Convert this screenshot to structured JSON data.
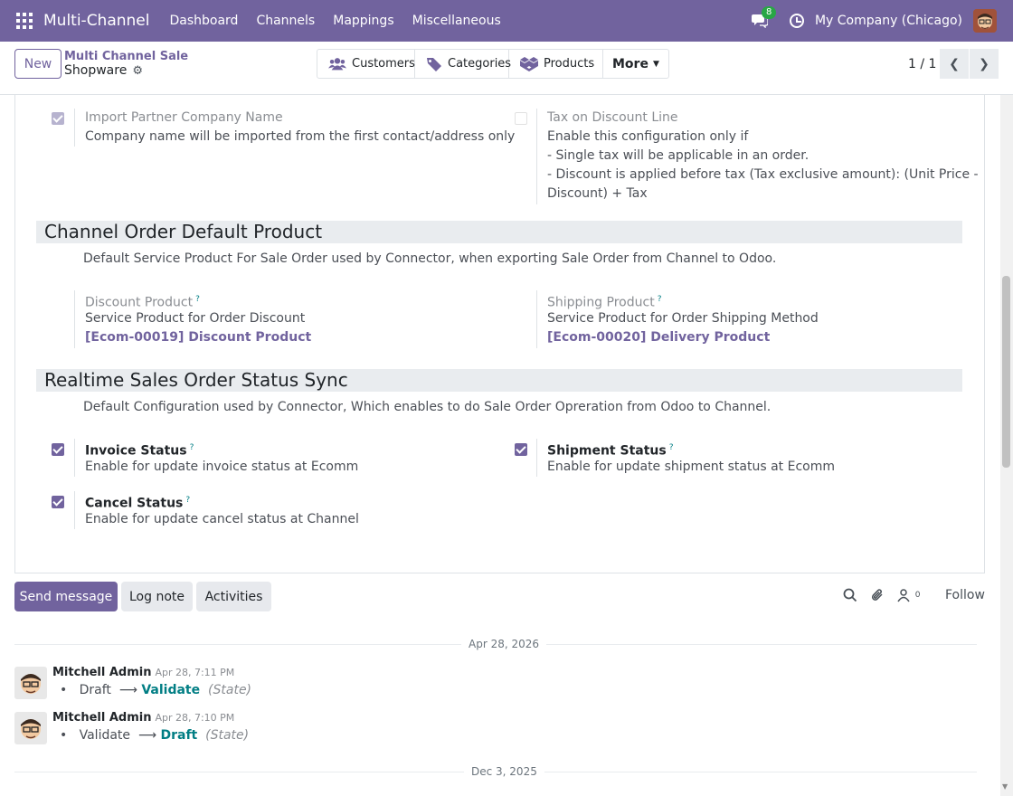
{
  "navbar": {
    "brand": "Multi-Channel",
    "menu": [
      "Dashboard",
      "Channels",
      "Mappings",
      "Miscellaneous"
    ],
    "chat_count": "8",
    "company": "My Company (Chicago)"
  },
  "control": {
    "new_label": "New",
    "breadcrumb_parent": "Multi Channel Sale",
    "breadcrumb_current": "Shopware",
    "smart_buttons": {
      "customers": "Customers",
      "categories": "Categories",
      "products": "Products",
      "more": "More"
    },
    "pager": "1 / 1"
  },
  "form": {
    "import_partner": {
      "label": "Import Partner Company Name",
      "help": "Company name will be imported from the first contact/address only"
    },
    "tax_discount": {
      "label": "Tax on Discount Line",
      "help_1": "Enable this configuration only if",
      "help_2": "- Single tax will be applicable in an order.",
      "help_3": "- Discount is applied before tax (Tax exclusive amount): (Unit Price -",
      "help_4": "Discount) + Tax"
    },
    "section_default_product": {
      "title": "Channel Order Default Product",
      "description": "Default Service Product For Sale Order used by Connector, when exporting Sale Order from Channel to Odoo."
    },
    "discount_product": {
      "label": "Discount Product",
      "help": "Service Product for Order Discount",
      "value": "[Ecom-00019] Discount Product"
    },
    "shipping_product": {
      "label": "Shipping Product",
      "help": "Service Product for Order Shipping Method",
      "value": "[Ecom-00020] Delivery Product"
    },
    "section_status_sync": {
      "title": "Realtime Sales Order Status Sync",
      "description": "Default Configuration used by Connector, Which enables to do Sale Order Opreration from Odoo to Channel."
    },
    "invoice_status": {
      "label": "Invoice Status",
      "help": "Enable for update invoice status at Ecomm"
    },
    "shipment_status": {
      "label": "Shipment Status",
      "help": "Enable for update shipment status at Ecomm"
    },
    "cancel_status": {
      "label": "Cancel Status",
      "help": "Enable for update cancel status at Channel"
    },
    "help_marker": "?"
  },
  "chatter": {
    "send_message": "Send message",
    "log_note": "Log note",
    "activities": "Activities",
    "followers_count": "0",
    "follow": "Follow",
    "date_1": "Apr 28, 2026",
    "date_2": "Dec 3, 2025",
    "messages": [
      {
        "author": "Mitchell Admin",
        "time": "Apr 28, 7:11 PM",
        "old": "Draft",
        "arrow": "⟶",
        "new": "Validate",
        "field": "(State)"
      },
      {
        "author": "Mitchell Admin",
        "time": "Apr 28, 7:10 PM",
        "old": "Validate",
        "arrow": "⟶",
        "new": "Draft",
        "field": "(State)"
      }
    ]
  }
}
